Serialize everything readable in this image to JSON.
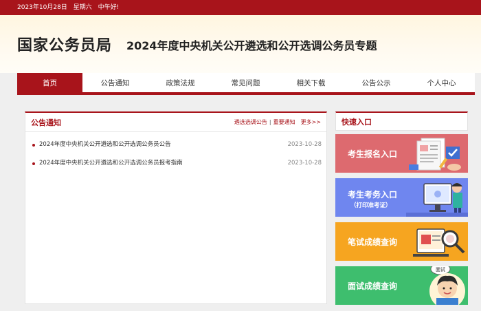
{
  "topbar": {
    "date": "2023年10月28日",
    "weekday": "星期六",
    "greeting": "中午好!"
  },
  "header": {
    "site_name": "国家公务员局",
    "topic": "2024年度中央机关公开遴选和公开选调公务员专题"
  },
  "nav": {
    "items": [
      "首页",
      "公告通知",
      "政策法规",
      "常见问题",
      "相关下载",
      "公告公示",
      "个人中心"
    ],
    "active": "首页"
  },
  "notices": {
    "title": "公告通知",
    "links": {
      "selection": "遴选选调公告",
      "separator": "|",
      "important": "重要通知",
      "more": "更多>>"
    },
    "items": [
      {
        "title": "2024年度中央机关公开遴选和公开选调公务员公告",
        "date": "2023-10-28"
      },
      {
        "title": "2024年度中央机关公开遴选和公开选调公务员报考指南",
        "date": "2023-10-28"
      }
    ]
  },
  "quick": {
    "title": "快速入口",
    "buttons": [
      {
        "label": "考生报名入口",
        "icon": "registration-form-icon"
      },
      {
        "label": "考生考务入口",
        "sub": "（打印准考证）",
        "icon": "computer-user-icon"
      },
      {
        "label": "笔试成绩查询",
        "icon": "magnifier-icon"
      },
      {
        "label": "面试成绩查询",
        "badge": "面试",
        "icon": "interviewee-icon"
      }
    ]
  },
  "colors": {
    "brand": "#a8141b",
    "btn1": "#dd6a6f",
    "btn2": "#6f86ef",
    "btn3": "#f6a520",
    "btn4": "#3ebe6e"
  }
}
